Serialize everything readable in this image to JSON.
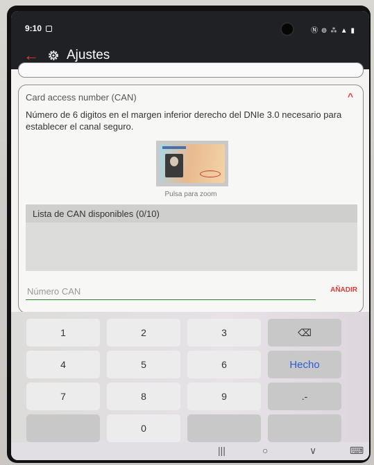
{
  "status": {
    "time": "9:10",
    "right": "Ⓝ ⊚ ⁂ ▲ ▮"
  },
  "appbar": {
    "back_icon": "arrow-back-icon",
    "settings_icon": "gear-icon",
    "title": "Ajustes"
  },
  "card": {
    "header": "Card access number (CAN)",
    "description": "Número de 6 digitos en el margen inferior derecho del DNIe 3.0 necesario para establecer el canal seguro.",
    "zoom_caption": "Pulsa para zoom",
    "list_header": "Lista de CAN disponibles (0/10)",
    "input_placeholder": "Número CAN",
    "add_label": "AÑADIR"
  },
  "keyboard": {
    "rows": [
      [
        "1",
        "2",
        "3",
        "⌫"
      ],
      [
        "4",
        "5",
        "6",
        "Hecho"
      ],
      [
        "7",
        "8",
        "9",
        ".-"
      ],
      [
        "",
        "0",
        "",
        ""
      ]
    ]
  },
  "navbar": {
    "recent": "|||",
    "home": "○",
    "back": "∨",
    "keyboard": "⌨"
  },
  "colors": {
    "accent": "#e03b3b",
    "appbar": "#202124",
    "input_underline": "#2e7d32",
    "done_key": "#2a5bd7"
  }
}
